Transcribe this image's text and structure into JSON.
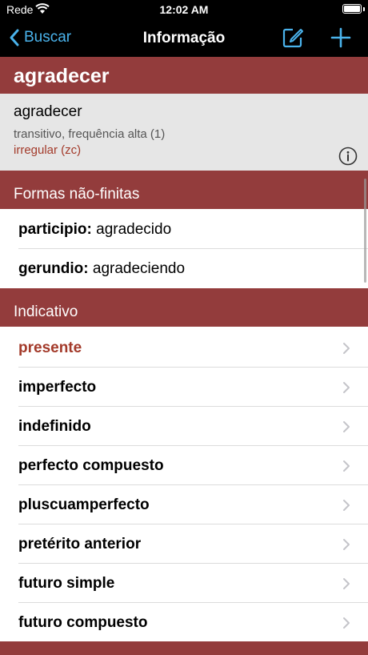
{
  "status_bar": {
    "carrier": "Rede",
    "time": "12:02 AM"
  },
  "nav": {
    "back_label": "Buscar",
    "title": "Informação"
  },
  "verb": {
    "title": "agradecer",
    "name": "agradecer",
    "description": "transitivo, frequência alta (1)",
    "irregularity": "irregular (zc)"
  },
  "sections": {
    "nonfinite_header": "Formas não-finitas",
    "indicative_header": "Indicativo"
  },
  "nonfinite": [
    {
      "key": "participio:",
      "value": "agradecido"
    },
    {
      "key": "gerundio:",
      "value": "agradeciendo"
    }
  ],
  "indicative": [
    "presente",
    "imperfecto",
    "indefinido",
    "perfecto compuesto",
    "pluscuamperfecto",
    "pretérito anterior",
    "futuro simple",
    "futuro compuesto"
  ],
  "colors": {
    "accent": "#4ab3ec",
    "header_red": "#933c3c",
    "active_red": "#a33a2a"
  }
}
